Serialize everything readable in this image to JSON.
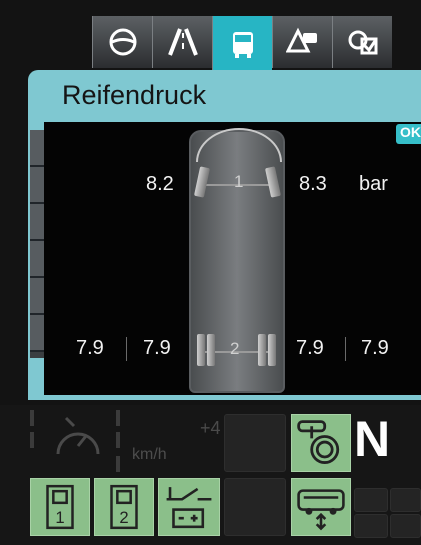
{
  "tabs": [
    {
      "icon": "steering-wheel-icon"
    },
    {
      "icon": "road-lane-icon"
    },
    {
      "icon": "bus-icon",
      "active": true
    },
    {
      "icon": "warning-message-icon"
    },
    {
      "icon": "key-check-icon"
    }
  ],
  "panel": {
    "title": "Reifendruck",
    "status": "OK",
    "unit": "bar",
    "axles": [
      {
        "label": "1",
        "left": "8.2",
        "right": "8.3"
      },
      {
        "label": "2",
        "left_outer": "7.9",
        "left_inner": "7.9",
        "right_inner": "7.9",
        "right_outer": "7.9"
      }
    ]
  },
  "bottom": {
    "speed_unit": "km/h",
    "speed_offset": "+4",
    "gear": "N",
    "buttons": [
      {
        "icon": "door-1-icon",
        "label": "1"
      },
      {
        "icon": "door-2-icon",
        "label": "2"
      },
      {
        "icon": "battery-switch-icon"
      },
      {
        "icon": "bus-kneeling-icon"
      },
      {
        "icon": "parking-brake-icon"
      }
    ]
  }
}
